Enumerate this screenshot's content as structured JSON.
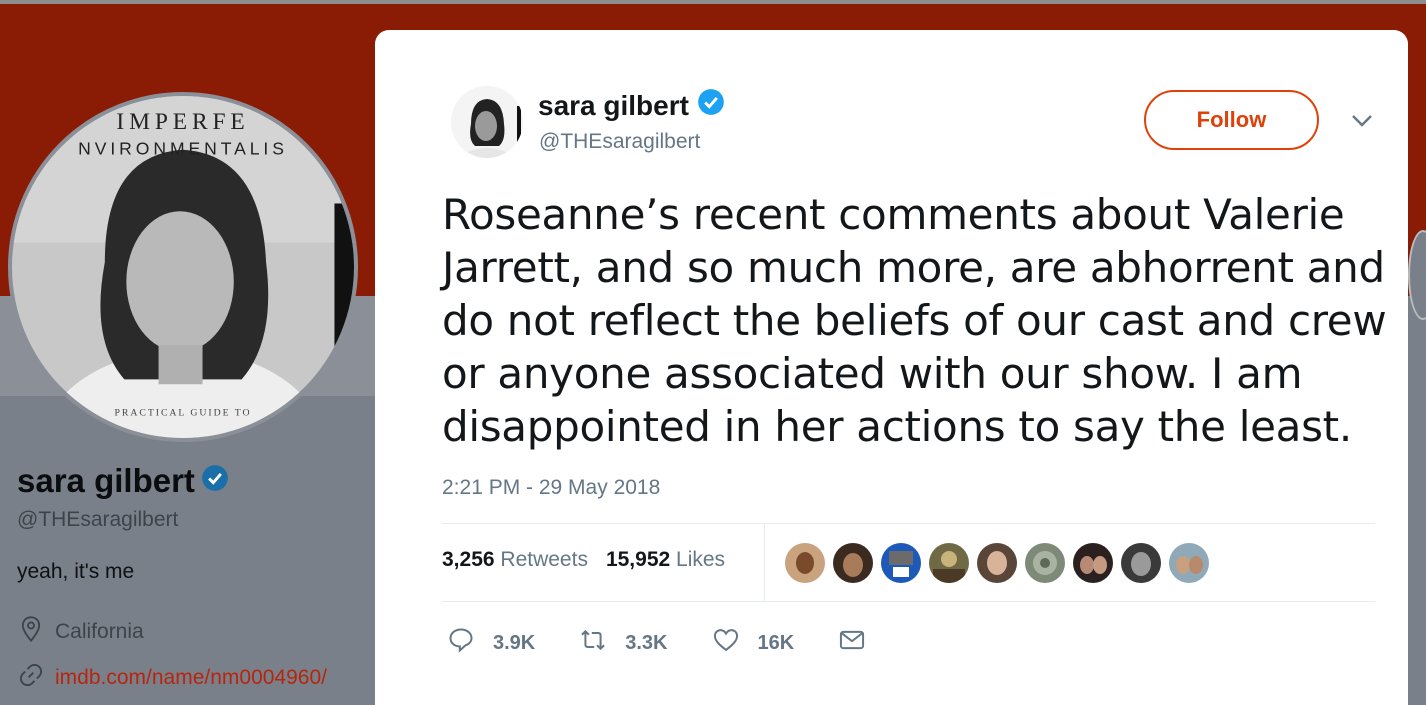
{
  "profile": {
    "name": "sara gilbert",
    "handle": "@THEsaragilbert",
    "bio": "yeah, it's me",
    "location": "California",
    "url": "imdb.com/name/nm0004960/",
    "avatar_text_top": "IMPERFE",
    "avatar_text_mid": "NVIRONMENTALIS",
    "avatar_text_bottom": "PRACTICAL GUIDE TO"
  },
  "tweet": {
    "author_name": "sara gilbert",
    "author_handle": "@THEsaragilbert",
    "follow_label": "Follow",
    "text": "Roseanne’s recent comments about Valerie Jarrett, and so much more, are abhorrent and do not reflect the beliefs of our cast and crew or anyone associated with our show. I am disappointed in her actions to say the least.",
    "timestamp": "2:21 PM - 29 May 2018",
    "retweets_count": "3,256",
    "retweets_label": "Retweets",
    "likes_count": "15,952",
    "likes_label": "Likes",
    "actions": {
      "reply": "3.9K",
      "retweet": "3.3K",
      "like": "16K"
    }
  },
  "colors": {
    "banner": "#8a1c06",
    "follow": "#e0400a",
    "verified": "#1da1f2",
    "link": "#b7250e"
  },
  "icons": [
    "verified-icon",
    "chevron-down-icon",
    "location-icon",
    "link-icon",
    "reply-icon",
    "retweet-icon",
    "heart-icon",
    "mail-icon"
  ]
}
